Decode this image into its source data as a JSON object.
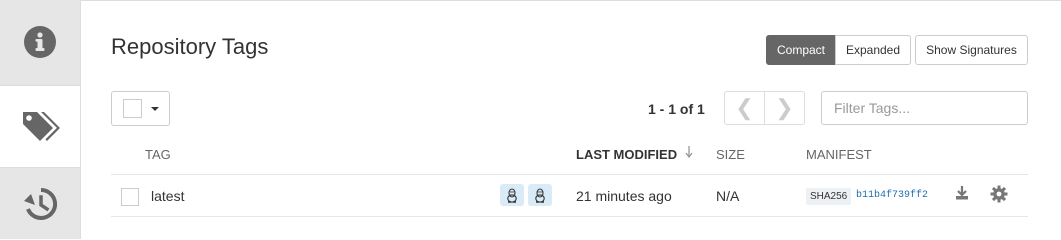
{
  "sidebar": {
    "items": [
      {
        "icon": "info-icon",
        "active": false
      },
      {
        "icon": "tags-icon",
        "active": true
      },
      {
        "icon": "history-icon",
        "active": false
      }
    ]
  },
  "header": {
    "title": "Repository Tags",
    "view_buttons": {
      "compact": "Compact",
      "expanded": "Expanded",
      "active": "compact"
    },
    "signatures_button": "Show Signatures"
  },
  "toolbar": {
    "pagination": "1 - 1 of 1",
    "prev_icon": "chevron-left-icon",
    "next_icon": "chevron-right-icon",
    "filter_placeholder": "Filter Tags..."
  },
  "table": {
    "columns": {
      "tag": "TAG",
      "last_modified": "LAST MODIFIED",
      "size": "SIZE",
      "manifest": "MANIFEST"
    },
    "sort_icon": "sort-down-icon",
    "rows": [
      {
        "tag": "latest",
        "platforms": [
          "linux-icon",
          "linux-icon"
        ],
        "last_modified": "21 minutes ago",
        "size": "N/A",
        "digest_algo": "SHA256",
        "digest": "b11b4f739ff2",
        "actions": [
          "download-icon",
          "gear-icon"
        ]
      }
    ]
  },
  "colors": {
    "sidebar_bg": "#e6e6e6",
    "icon_gray": "#666666",
    "active_button": "#666666",
    "link_blue": "#1f6fb0",
    "badge_blue": "#d9ebf7"
  }
}
